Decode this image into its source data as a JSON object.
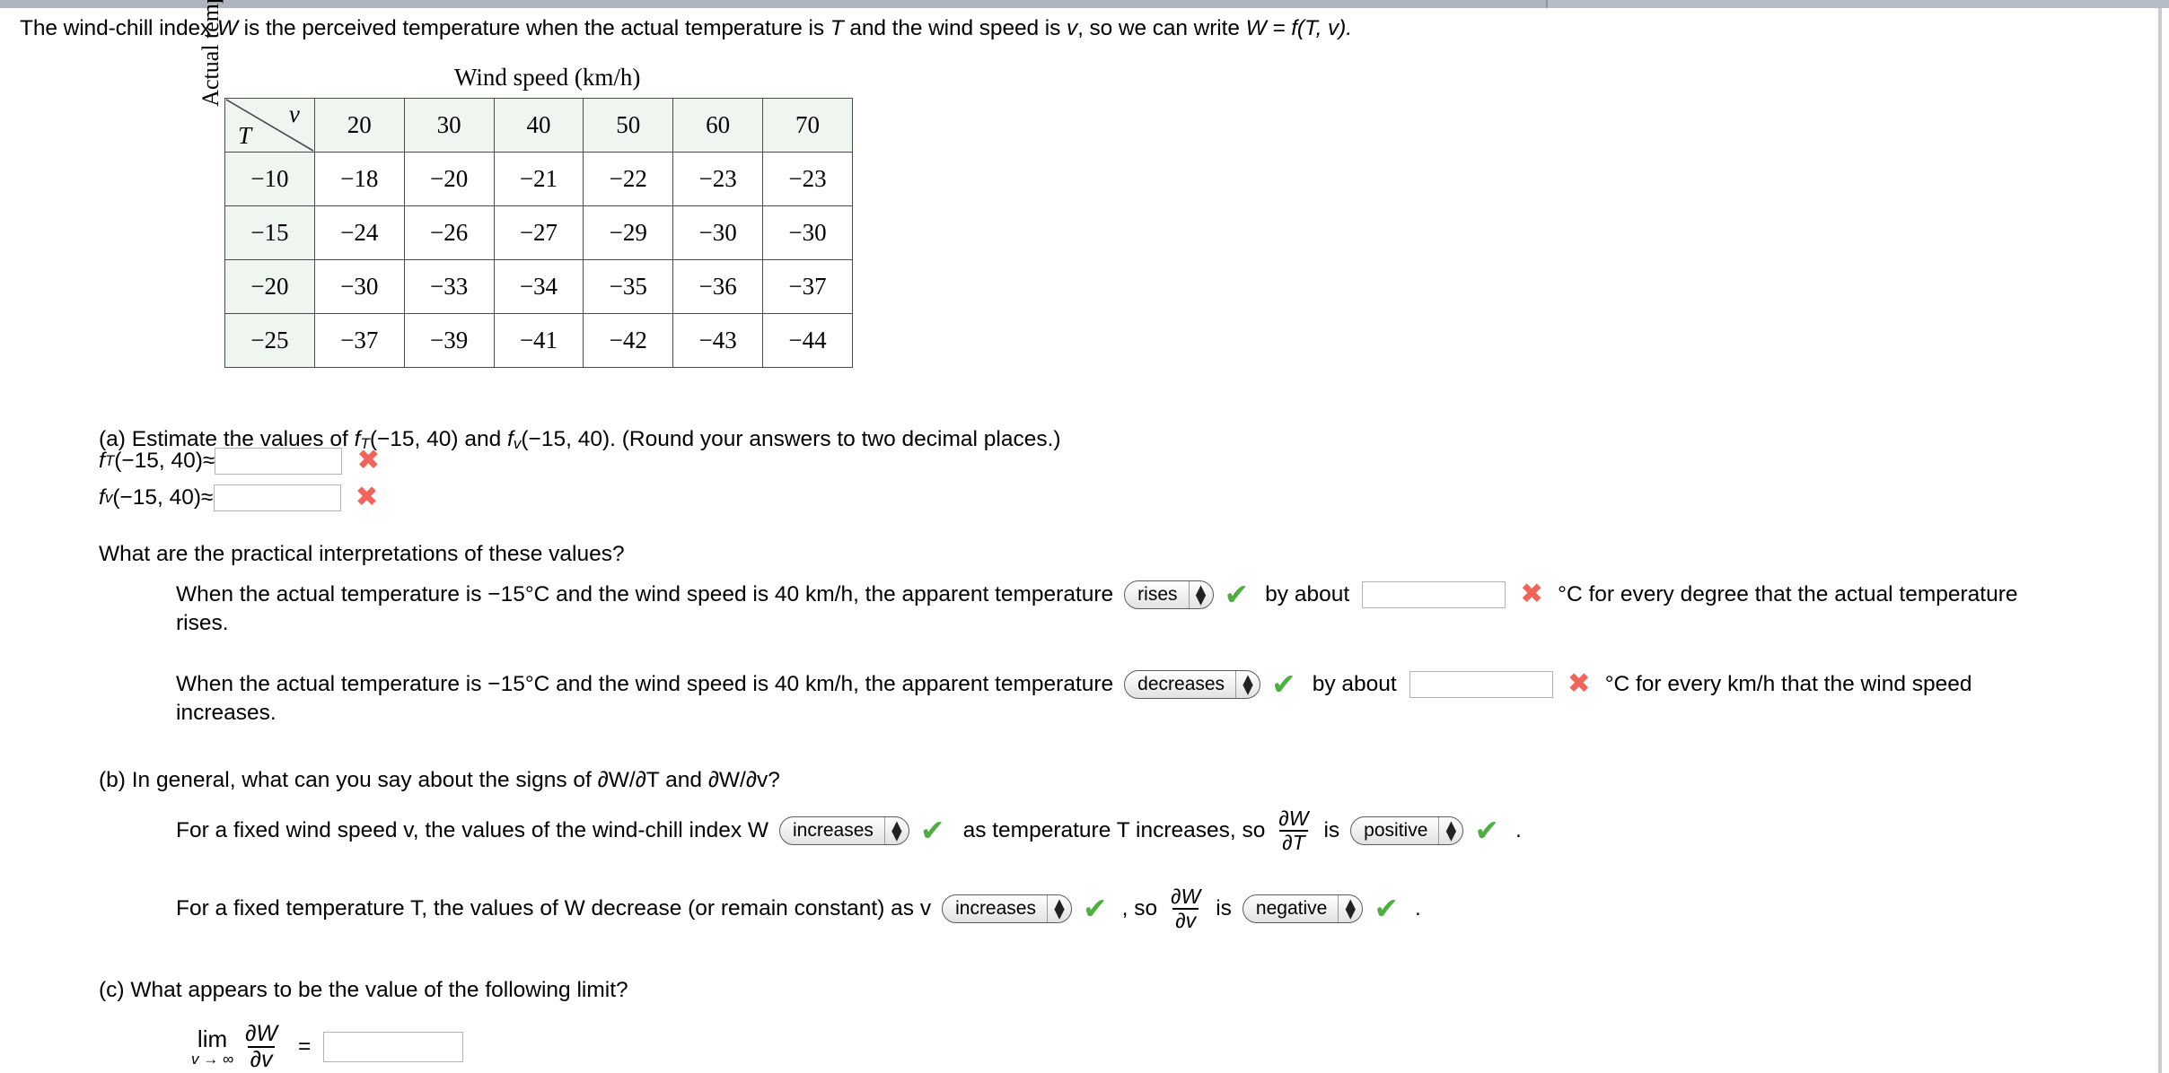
{
  "intro": {
    "parts": [
      "The wind-chill index ",
      "W",
      " is the perceived temperature when the actual temperature is ",
      "T",
      " and the wind speed is ",
      "v",
      ", so we can write  ",
      "W = f(T, v)."
    ],
    "full": "The wind-chill index W is the perceived temperature when the actual temperature is T and the wind speed is v, so we can write  W = f(T, v)."
  },
  "table": {
    "caption": "Wind speed (km/h)",
    "ylabel": "Actual temperature  (°C)",
    "corner_col": "v",
    "corner_row": "T",
    "col_headers": [
      "20",
      "30",
      "40",
      "50",
      "60",
      "70"
    ],
    "row_headers": [
      "−10",
      "−15",
      "−20",
      "−25"
    ],
    "rows": [
      [
        "−18",
        "−20",
        "−21",
        "−22",
        "−23",
        "−23"
      ],
      [
        "−24",
        "−26",
        "−27",
        "−29",
        "−30",
        "−30"
      ],
      [
        "−30",
        "−33",
        "−34",
        "−35",
        "−36",
        "−37"
      ],
      [
        "−37",
        "−39",
        "−41",
        "−42",
        "−43",
        "−44"
      ]
    ],
    "header_bg": "#eff5ef",
    "border_color": "#4a4a4a"
  },
  "part_a": {
    "prompt_pre": "(a) Estimate the values of  ",
    "prompt_f1": "f",
    "prompt_f1_sub": "T",
    "prompt_mid": "(−15, 40) and ",
    "prompt_f2": "f",
    "prompt_f2_sub": "v",
    "prompt_post": "(−15, 40).  (Round your answers to two decimal places.)",
    "rows": [
      {
        "fn": "f",
        "sub": "T",
        "args": "(−15, 40)≈",
        "value": "",
        "placeholder": "",
        "status": "incorrect",
        "status_glyph": "✖"
      },
      {
        "fn": "f",
        "sub": "v",
        "args": "(−15, 40)≈",
        "value": "",
        "placeholder": "",
        "status": "incorrect",
        "status_glyph": "✖"
      }
    ]
  },
  "interpretations": {
    "heading": "What are the practical interpretations of these values?",
    "items": [
      {
        "text_before": "When the actual temperature is −15°C and the wind speed is 40 km/h, the apparent temperature",
        "select_value": "rises",
        "select_status_glyph": "✔",
        "text_mid": "by about",
        "input_value": "",
        "input_status_glyph": "✖",
        "text_after": "°C for every degree that the actual temperature",
        "text_wrap": "rises."
      },
      {
        "text_before": "When the actual temperature is −15°C and the wind speed is 40 km/h, the apparent temperature",
        "select_value": "decreases",
        "select_status_glyph": "✔",
        "text_mid": "by about",
        "input_value": "",
        "input_status_glyph": "✖",
        "text_after": "°C for every km/h that the wind speed",
        "text_wrap": "increases."
      }
    ]
  },
  "part_b": {
    "prompt": "(b) In general, what can you say about the signs of  ∂W/∂T and ∂W/∂v?",
    "line1": {
      "text_before": "For a fixed wind speed v, the values of the wind-chill index W",
      "select_value": "increases",
      "select_status_glyph": "✔",
      "text_mid": "as temperature T increases, so",
      "frac_num": "∂W",
      "frac_den": "∂T",
      "text_is": "is",
      "select2_value": "positive",
      "select2_status_glyph": "✔",
      "text_end": "."
    },
    "line2": {
      "text_before": "For a fixed temperature T, the values of W decrease (or remain constant) as v",
      "select_value": "increases",
      "select_status_glyph": "✔",
      "text_mid": ", so",
      "frac_num": "∂W",
      "frac_den": "∂v",
      "text_is": "is",
      "select2_value": "negative",
      "select2_status_glyph": "✔",
      "text_end": "."
    }
  },
  "part_c": {
    "prompt": "(c) What appears to be the value of the following limit?",
    "lim": "lim",
    "lim_under": "v → ∞",
    "frac_num": "∂W",
    "frac_den": "∂v",
    "equals": "=",
    "input_value": "",
    "placeholder": ""
  },
  "colors": {
    "correct": "#4caf3f",
    "incorrect": "#f2645a",
    "table_header": "#eff5ef",
    "chrome": "#b6bcc6"
  }
}
